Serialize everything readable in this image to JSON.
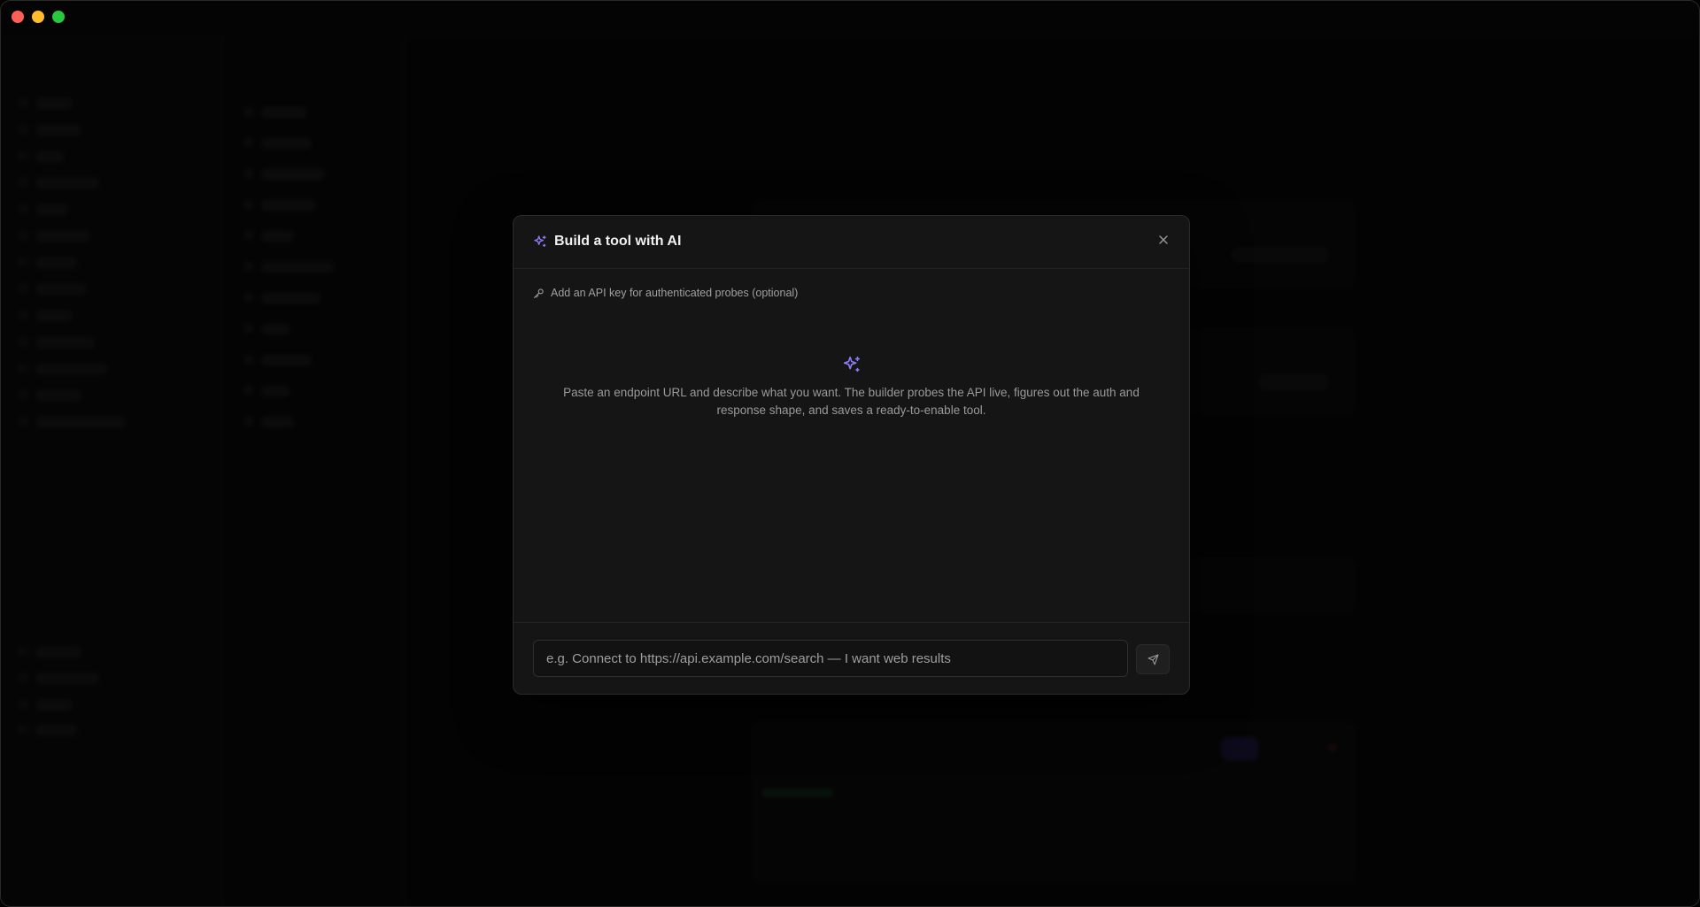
{
  "modal": {
    "title": "Build a tool with AI",
    "title_icon": "sparkles-icon",
    "close_icon": "close-icon",
    "api_key_link": "Add an API key for authenticated probes (optional)",
    "api_key_icon": "key-icon",
    "empty_state": {
      "icon": "sparkles-icon",
      "text": "Paste an endpoint URL and describe what you want. The builder probes the API live, figures out the auth and response shape, and saves a ready-to-enable tool."
    },
    "input": {
      "value": "",
      "placeholder": "e.g. Connect to https://api.example.com/search — I want web results"
    },
    "send_icon": "send-icon"
  },
  "colors": {
    "accent": "#7c6cf0",
    "modal_bg": "#151515",
    "backdrop": "#000000"
  }
}
